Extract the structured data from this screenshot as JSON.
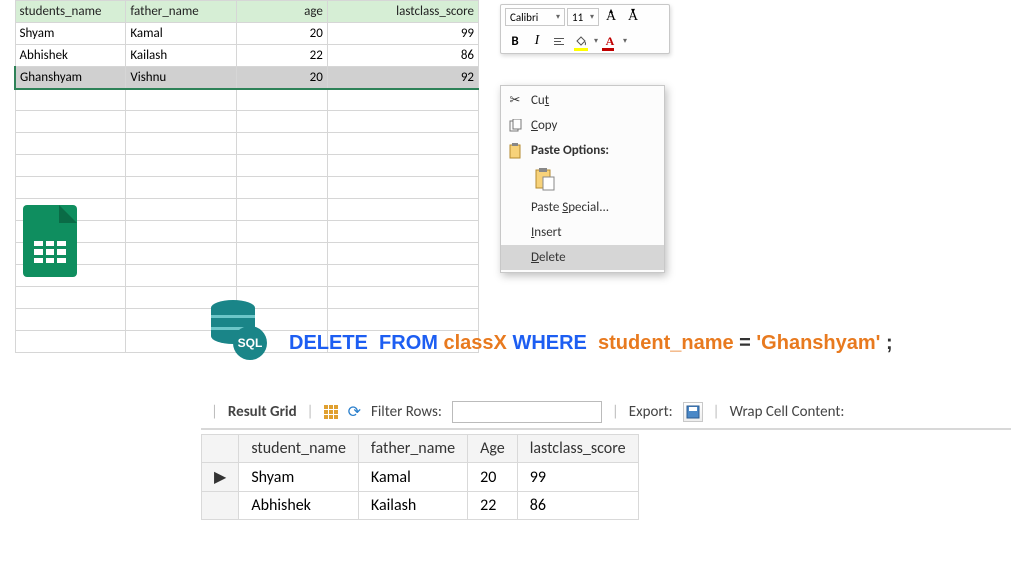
{
  "excel": {
    "headers": [
      "students_name",
      "father_name",
      "age",
      "lastclass_score"
    ],
    "rows": [
      {
        "name": "Shyam",
        "father": "Kamal",
        "age": "20",
        "score": "99"
      },
      {
        "name": "Abhishek",
        "father": "Kailash",
        "age": "22",
        "score": "86"
      },
      {
        "name": "Ghanshyam",
        "father": "Vishnu",
        "age": "20",
        "score": "92"
      }
    ]
  },
  "toolbar": {
    "font_name": "Calibri",
    "font_size": "11",
    "bigA": "A",
    "bold": "B",
    "italic": "I",
    "fontcolor_letter": "A"
  },
  "context_menu": {
    "cut": "Cut",
    "copy": "Copy",
    "paste_options": "Paste Options:",
    "paste_special": "Paste Special...",
    "insert": "Insert",
    "delete": "Delete"
  },
  "sql_logo": "SQL",
  "sql_query": {
    "delete": "DELETE",
    "from": "FROM",
    "table": "classX",
    "where": "WHERE",
    "column": "student_name",
    "eq": "=",
    "value": "'Ghanshyam'",
    "semi": ";"
  },
  "result": {
    "title": "Result Grid",
    "filter_label": "Filter Rows:",
    "export_label": "Export:",
    "wrap_label": "Wrap Cell Content:",
    "headers": [
      "student_name",
      "father_name",
      "Age",
      "lastclass_score"
    ],
    "rows": [
      {
        "marker": "▶",
        "c0": "Shyam",
        "c1": "Kamal",
        "c2": "20",
        "c3": "99"
      },
      {
        "marker": "",
        "c0": "Abhishek",
        "c1": "Kailash",
        "c2": "22",
        "c3": "86"
      }
    ]
  }
}
